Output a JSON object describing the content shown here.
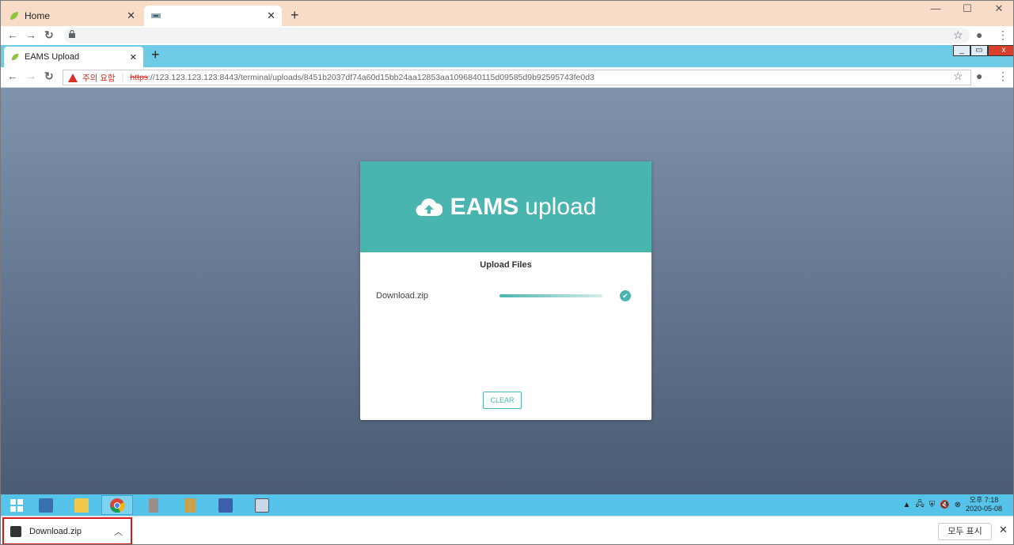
{
  "outer_browser": {
    "tabs": [
      {
        "title": "Home"
      },
      {
        "title": ""
      }
    ],
    "new_tab": "+",
    "close_glyph": "✕",
    "window_controls": {
      "minimize": "—",
      "maximize": "☐",
      "close": "✕"
    }
  },
  "inner_browser": {
    "tab_title": "EAMS Upload",
    "new_tab": "+",
    "close_glyph": "✕",
    "warning_text": "주의 요함",
    "url_scheme": "https",
    "url_rest": "://123.123.123.123:8443/terminal/uploads/8451b2037df74a60d15bb24aa12853aa1096840115d09585d9b92595743fe0d3",
    "window_controls": {
      "minimize": "_",
      "restore": "▭",
      "close": "x"
    }
  },
  "upload_card": {
    "brand_bold": "EAMS",
    "brand_light": "upload",
    "section_title": "Upload Files",
    "files": [
      {
        "name": "Download.zip",
        "progress": 1.0,
        "status": "complete"
      }
    ],
    "clear_button": "CLEAR",
    "accent_color": "#4ab5ae"
  },
  "taskbar": {
    "clock_period": "오후 7:18",
    "clock_date": "2020-05-08",
    "tray_arrow": "▲"
  },
  "download_bar": {
    "file_name": "Download.zip",
    "show_all": "모두 표시",
    "close_glyph": "✕"
  }
}
